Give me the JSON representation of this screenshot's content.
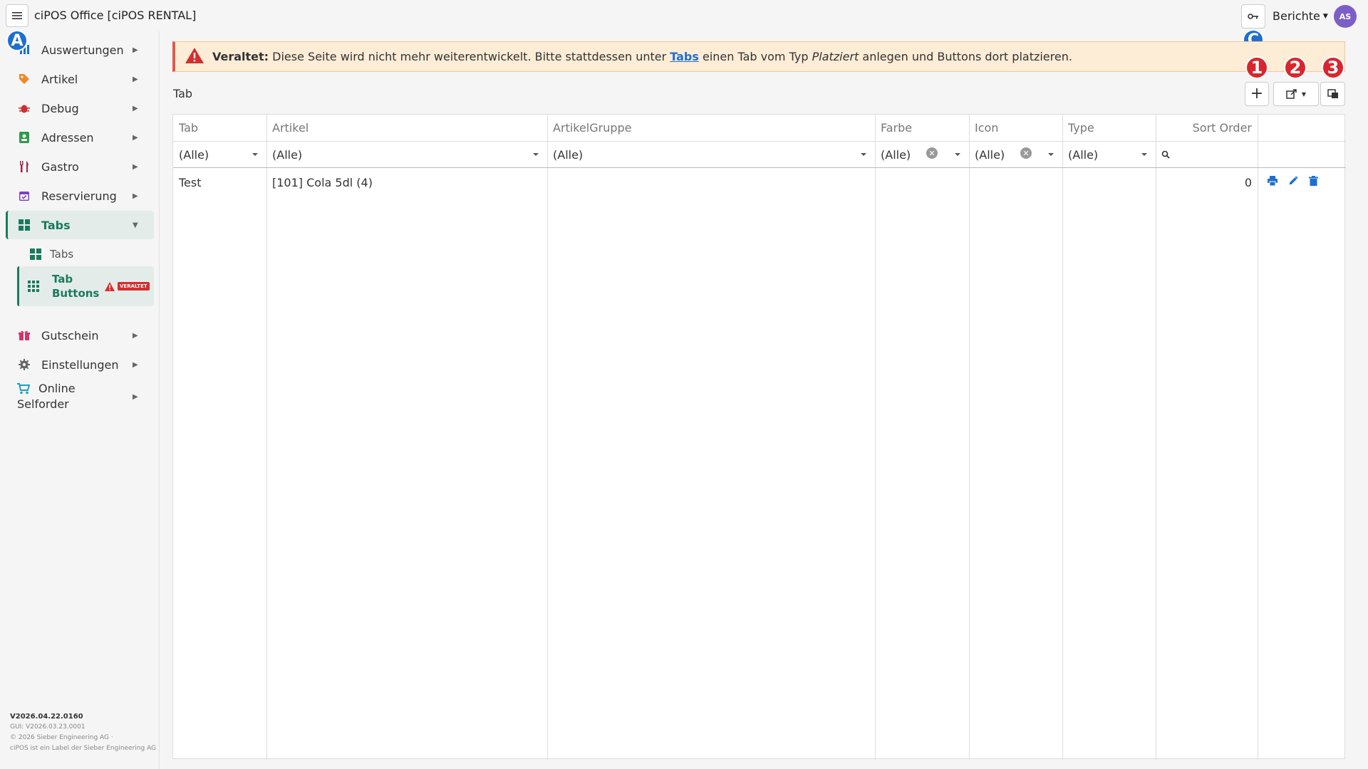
{
  "app": {
    "title": "ciPOS Office [ciPOS RENTAL]",
    "reports_label": "Berichte",
    "avatar_initials": "AS"
  },
  "sidebar": {
    "items": [
      {
        "label": "Auswertungen",
        "icon": "chart-icon"
      },
      {
        "label": "Artikel",
        "icon": "tag-icon"
      },
      {
        "label": "Debug",
        "icon": "bug-icon"
      },
      {
        "label": "Adressen",
        "icon": "address-book-icon"
      },
      {
        "label": "Gastro",
        "icon": "utensils-icon"
      },
      {
        "label": "Reservierung",
        "icon": "calendar-check-icon"
      },
      {
        "label": "Tabs",
        "icon": "grid-icon"
      },
      {
        "label": "Gutschein",
        "icon": "gift-icon"
      },
      {
        "label": "Einstellungen",
        "icon": "gear-icon"
      },
      {
        "label": "Online Selforder",
        "label_line1": "Online",
        "label_line2": "Selforder",
        "icon": "cart-icon"
      }
    ],
    "sub_items": [
      {
        "label": "Tabs"
      },
      {
        "label": "Tab Buttons",
        "label_line1": "Tab",
        "label_line2": "Buttons",
        "badge": "VERALTET"
      }
    ],
    "footer": {
      "version": "V2026.04.22.0160",
      "gui_version": "GUI: V2026.03.23.0001",
      "copyright": "© 2026 Sieber Engineering AG ·",
      "label_note": "ciPOS ist ein Label der Sieber Engineering AG"
    }
  },
  "annotations": {
    "a": "A",
    "c": "C",
    "n1": "1",
    "n2": "2",
    "n3": "3"
  },
  "alert": {
    "strong": "Veraltet:",
    "text1": " Diese Seite wird nicht mehr weiterentwickelt. Bitte stattdessen unter ",
    "link": "Tabs",
    "text2": " einen Tab vom Typ ",
    "italic": "Platziert",
    "text3": " anlegen und Buttons dort platzieren."
  },
  "section": {
    "title": "Tab"
  },
  "table": {
    "columns": [
      "Tab",
      "Artikel",
      "ArtikelGruppe",
      "Farbe",
      "Icon",
      "Type",
      "Sort Order"
    ],
    "filters": [
      "(Alle)",
      "(Alle)",
      "(Alle)",
      "(Alle)",
      "(Alle)",
      "(Alle)"
    ],
    "rows": [
      {
        "tab": "Test",
        "artikel": "[101] Cola 5dl (4)",
        "artikelgruppe": "",
        "farbe": "",
        "icon": "",
        "type": "",
        "sort_order": "0"
      }
    ]
  },
  "colors": {
    "accent": "#1a7a5e",
    "alert_bg": "#fdecd6",
    "alert_border": "#e05a4e",
    "link": "#1e6fd0",
    "avatar": "#7b5fc7",
    "badge_blue": "#1e6fd0",
    "badge_red": "#d9262e"
  }
}
